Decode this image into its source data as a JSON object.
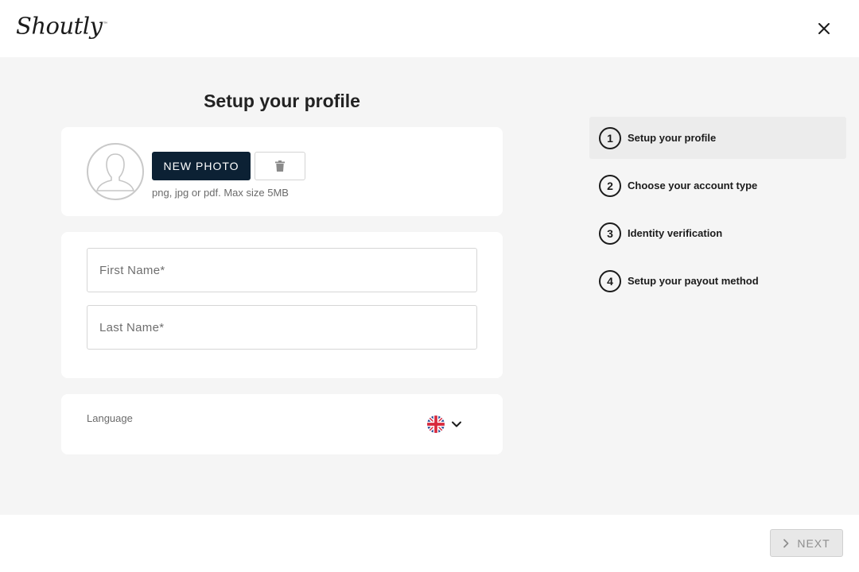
{
  "header": {
    "logo_text": "Shoutly",
    "logo_mark": "™",
    "close_icon": "close-icon"
  },
  "main": {
    "title": "Setup your profile",
    "photo": {
      "new_photo_label": "NEW PHOTO",
      "delete_icon": "trash-icon",
      "hint": "png, jpg or pdf. Max size 5MB"
    },
    "name": {
      "first_name_placeholder": "First Name*",
      "first_name_value": "",
      "last_name_placeholder": "Last Name*",
      "last_name_value": ""
    },
    "language": {
      "label": "Language",
      "selected_flag": "uk-flag-icon"
    }
  },
  "steps": [
    {
      "number": "1",
      "label": "Setup your profile",
      "active": true
    },
    {
      "number": "2",
      "label": "Choose your account type",
      "active": false
    },
    {
      "number": "3",
      "label": "Identity verification",
      "active": false
    },
    {
      "number": "4",
      "label": "Setup your payout method",
      "active": false
    }
  ],
  "footer": {
    "next_label": "NEXT",
    "next_enabled": false
  },
  "colors": {
    "primary_button": "#0c2134",
    "background": "#f5f5f5",
    "active_step": "#ececec"
  }
}
